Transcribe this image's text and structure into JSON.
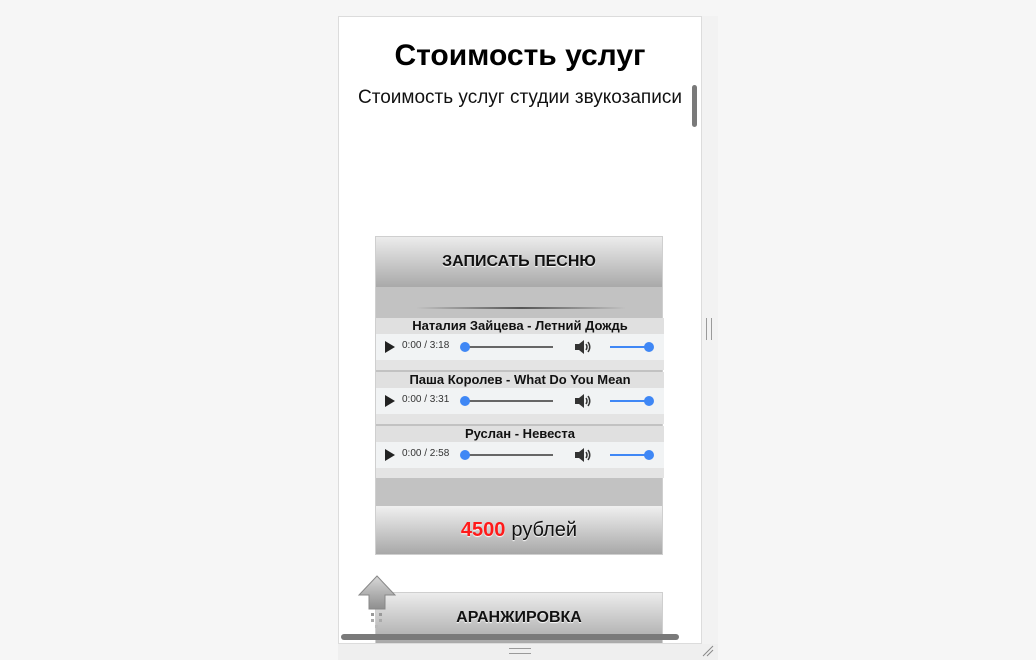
{
  "page": {
    "title": "Стоимость услуг",
    "subtitle": "Стоимость услуг студии звукозаписи"
  },
  "cards": [
    {
      "header": "ЗАПИСАТЬ ПЕСНЮ",
      "tracks": [
        {
          "title": "Наталия Зайцева - Летний Дождь",
          "time": "0:00 / 3:18"
        },
        {
          "title": "Паша Королев - What Do You Mean",
          "time": "0:00 / 3:31"
        },
        {
          "title": "Руслан - Невеста",
          "time": "0:00 / 2:58"
        }
      ],
      "price": {
        "amount": "4500",
        "currency": "рублей"
      }
    },
    {
      "header": "АРАНЖИРОВКА"
    }
  ],
  "icons": {
    "play": "play-icon",
    "volume": "volume-icon",
    "scroll_top": "arrow-up-icon"
  },
  "colors": {
    "price_accent": "#ff1a1a",
    "player_accent": "#3f87f5"
  }
}
